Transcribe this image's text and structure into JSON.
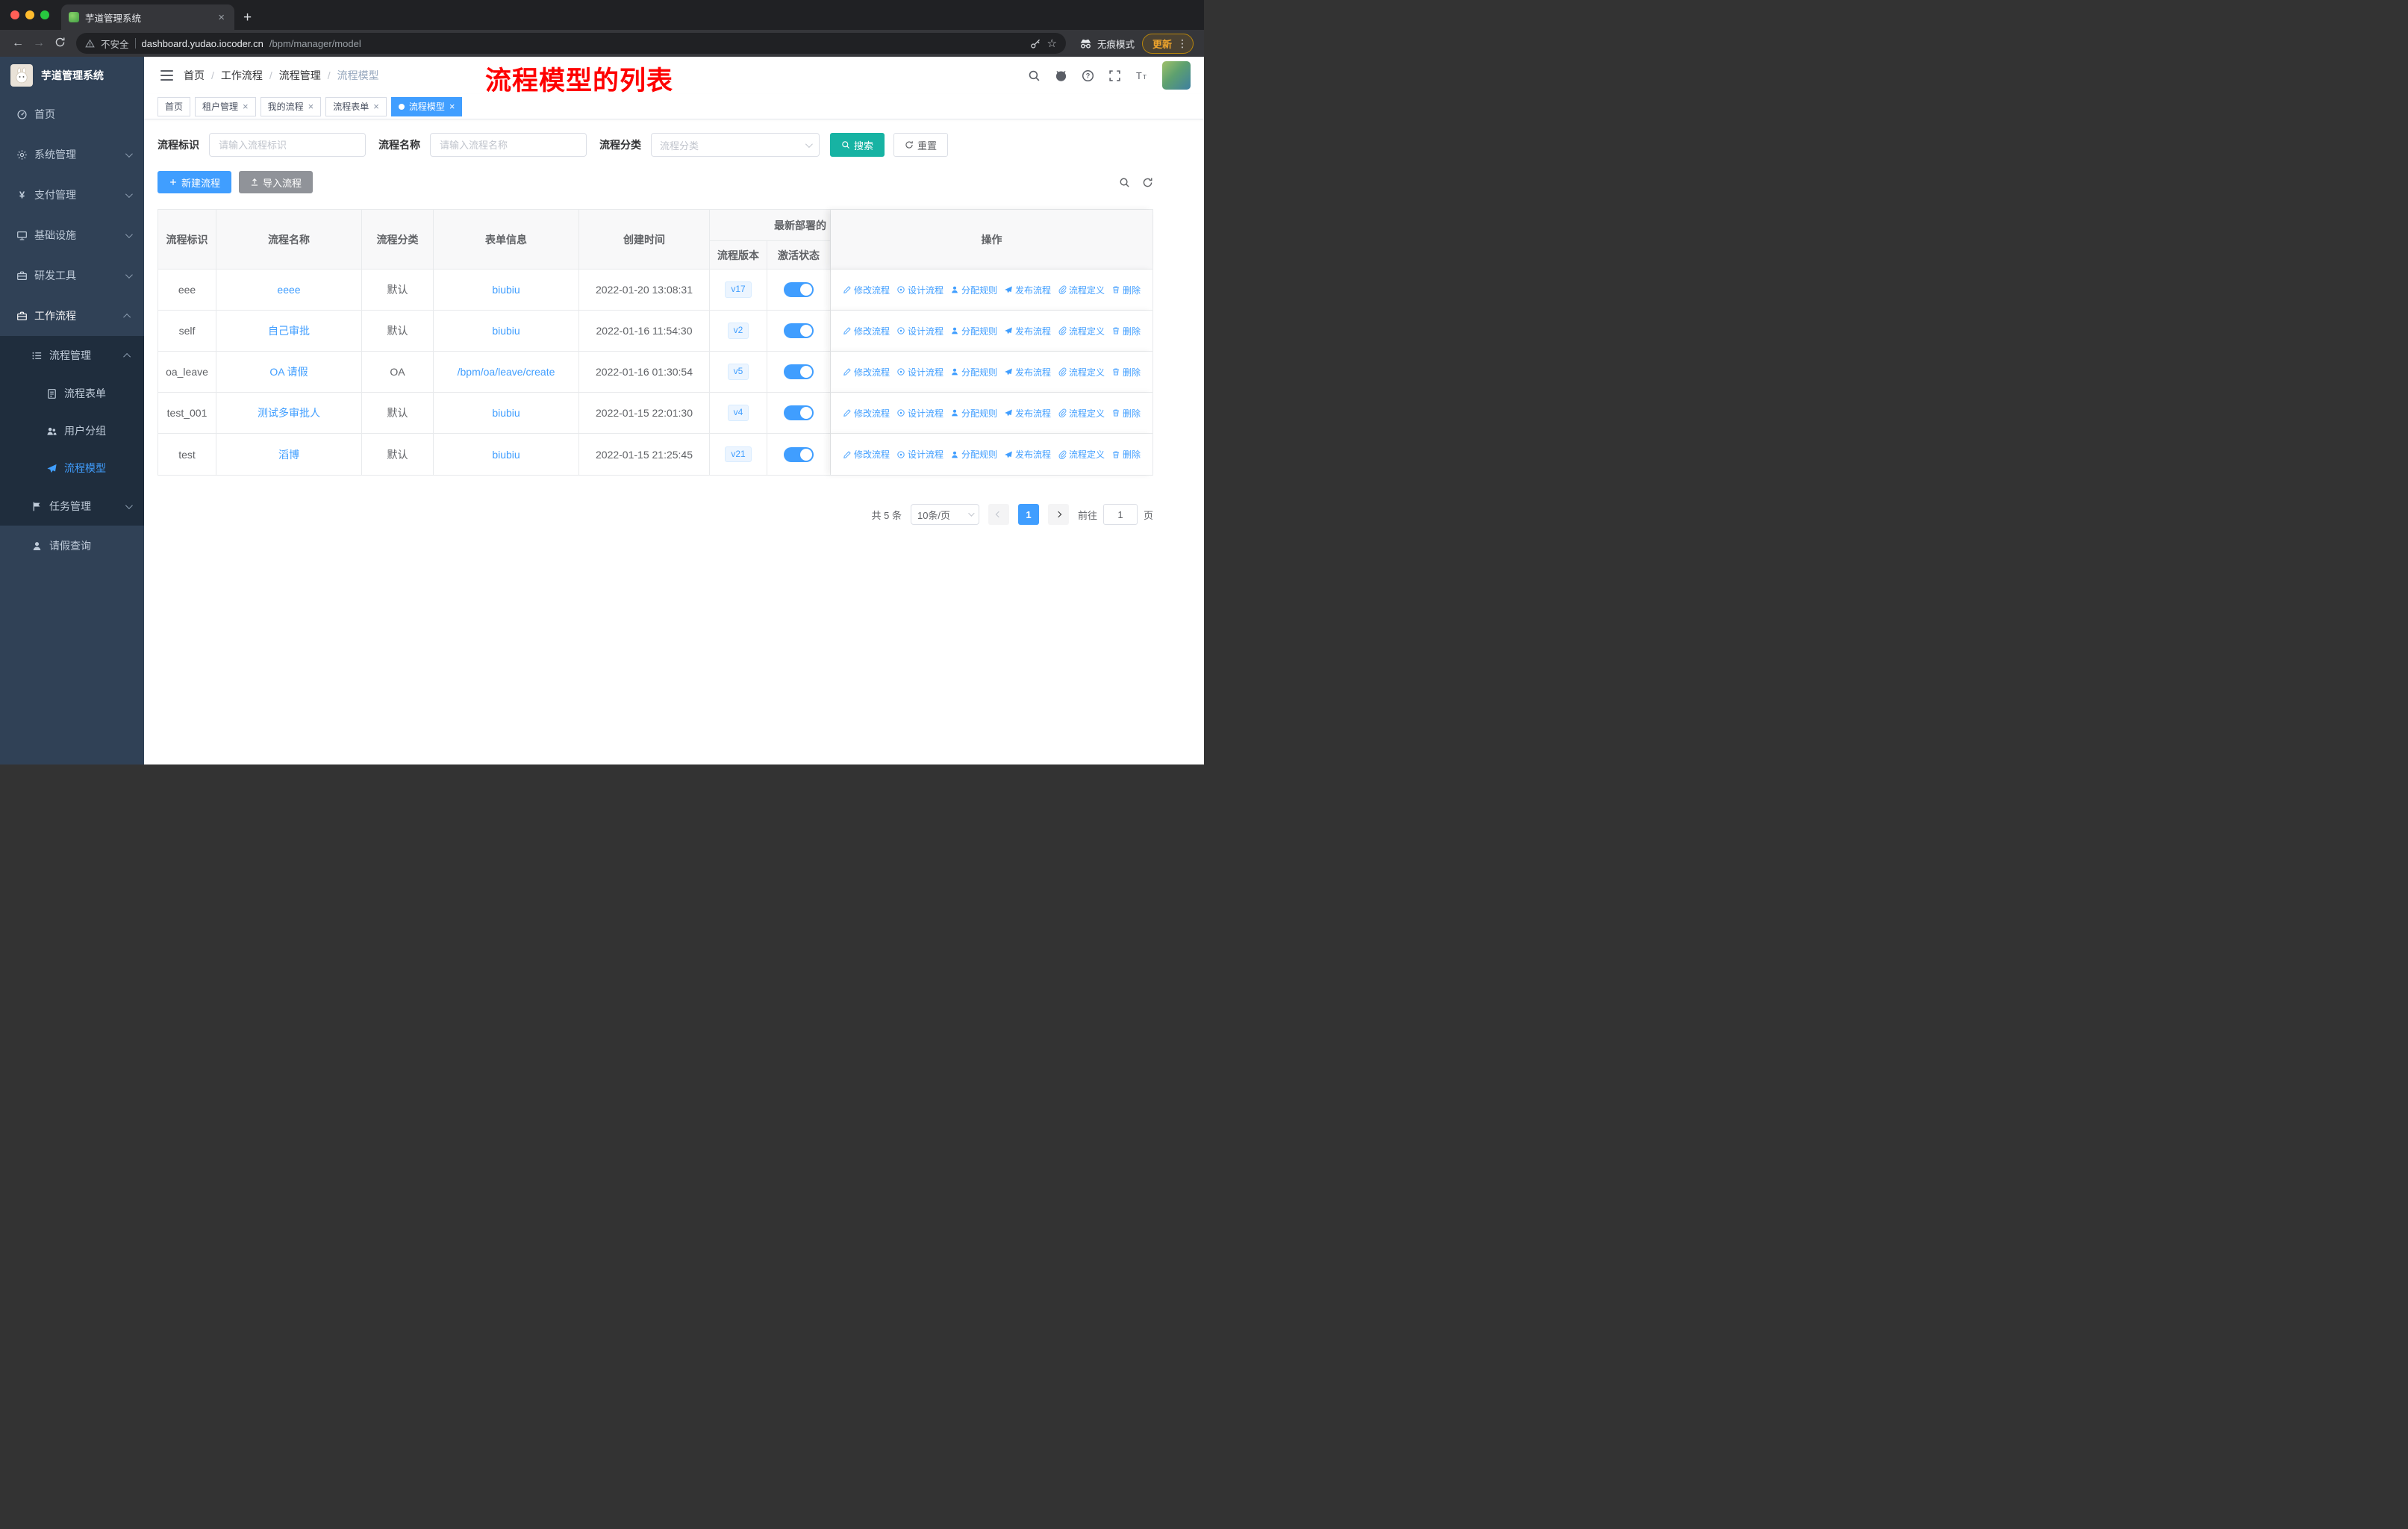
{
  "colors": {
    "primary": "#409eff",
    "search-button": "#17b3a3",
    "annotation-red": "#fe0000",
    "sidebar-bg": "#304156",
    "sidebar-sub-bg": "#1f2d3d",
    "sidebar-text": "#bfcbd9"
  },
  "browser": {
    "tab_title": "芋道管理系统",
    "security_label": "不安全",
    "url_host": "dashboard.yudao.iocoder.cn",
    "url_path": "/bpm/manager/model",
    "incognito_label": "无痕模式",
    "update_label": "更新"
  },
  "sidebar": {
    "app_title": "芋道管理系统",
    "items": [
      {
        "label": "首页"
      },
      {
        "label": "系统管理"
      },
      {
        "label": "支付管理"
      },
      {
        "label": "基础设施"
      },
      {
        "label": "研发工具"
      },
      {
        "label": "工作流程"
      },
      {
        "label": "流程管理"
      },
      {
        "label": "流程表单"
      },
      {
        "label": "用户分组"
      },
      {
        "label": "流程模型"
      },
      {
        "label": "任务管理"
      },
      {
        "label": "请假查询"
      }
    ]
  },
  "navbar": {
    "breadcrumb": [
      "首页",
      "工作流程",
      "流程管理",
      "流程模型"
    ],
    "annotation": "流程模型的列表"
  },
  "tags": [
    {
      "label": "首页"
    },
    {
      "label": "租户管理"
    },
    {
      "label": "我的流程"
    },
    {
      "label": "流程表单"
    },
    {
      "label": "流程模型"
    }
  ],
  "filters": {
    "key_label": "流程标识",
    "key_placeholder": "请输入流程标识",
    "name_label": "流程名称",
    "name_placeholder": "请输入流程名称",
    "category_label": "流程分类",
    "category_placeholder": "流程分类",
    "search_label": "搜索",
    "reset_label": "重置"
  },
  "toolbar": {
    "create_label": "新建流程",
    "import_label": "导入流程"
  },
  "table": {
    "col_key": "流程标识",
    "col_name": "流程名称",
    "col_category": "流程分类",
    "col_form": "表单信息",
    "col_created": "创建时间",
    "group_header": "最新部署的",
    "col_version": "流程版本",
    "col_active": "激活状态",
    "col_ops": "操作",
    "ops": {
      "modify": "修改流程",
      "design": "设计流程",
      "assign": "分配规则",
      "publish": "发布流程",
      "definition": "流程定义",
      "delete": "删除"
    },
    "rows": [
      {
        "key": "eee",
        "name": "eeee",
        "category": "默认",
        "form": "biubiu",
        "created": "2022-01-20 13:08:31",
        "version": "v17"
      },
      {
        "key": "self",
        "name": "自己审批",
        "category": "默认",
        "form": "biubiu",
        "created": "2022-01-16 11:54:30",
        "version": "v2"
      },
      {
        "key": "oa_leave",
        "name": "OA 请假",
        "category": "OA",
        "form": "/bpm/oa/leave/create",
        "created": "2022-01-16 01:30:54",
        "version": "v5"
      },
      {
        "key": "test_001",
        "name": "测试多审批人",
        "category": "默认",
        "form": "biubiu",
        "created": "2022-01-15 22:01:30",
        "version": "v4"
      },
      {
        "key": "test",
        "name": "滔博",
        "category": "默认",
        "form": "biubiu",
        "created": "2022-01-15 21:25:45",
        "version": "v21"
      }
    ]
  },
  "pagination": {
    "total": "共 5 条",
    "page_size": "10条/页",
    "current_page": "1",
    "goto_label": "前往",
    "goto_value": "1",
    "page_unit": "页"
  }
}
